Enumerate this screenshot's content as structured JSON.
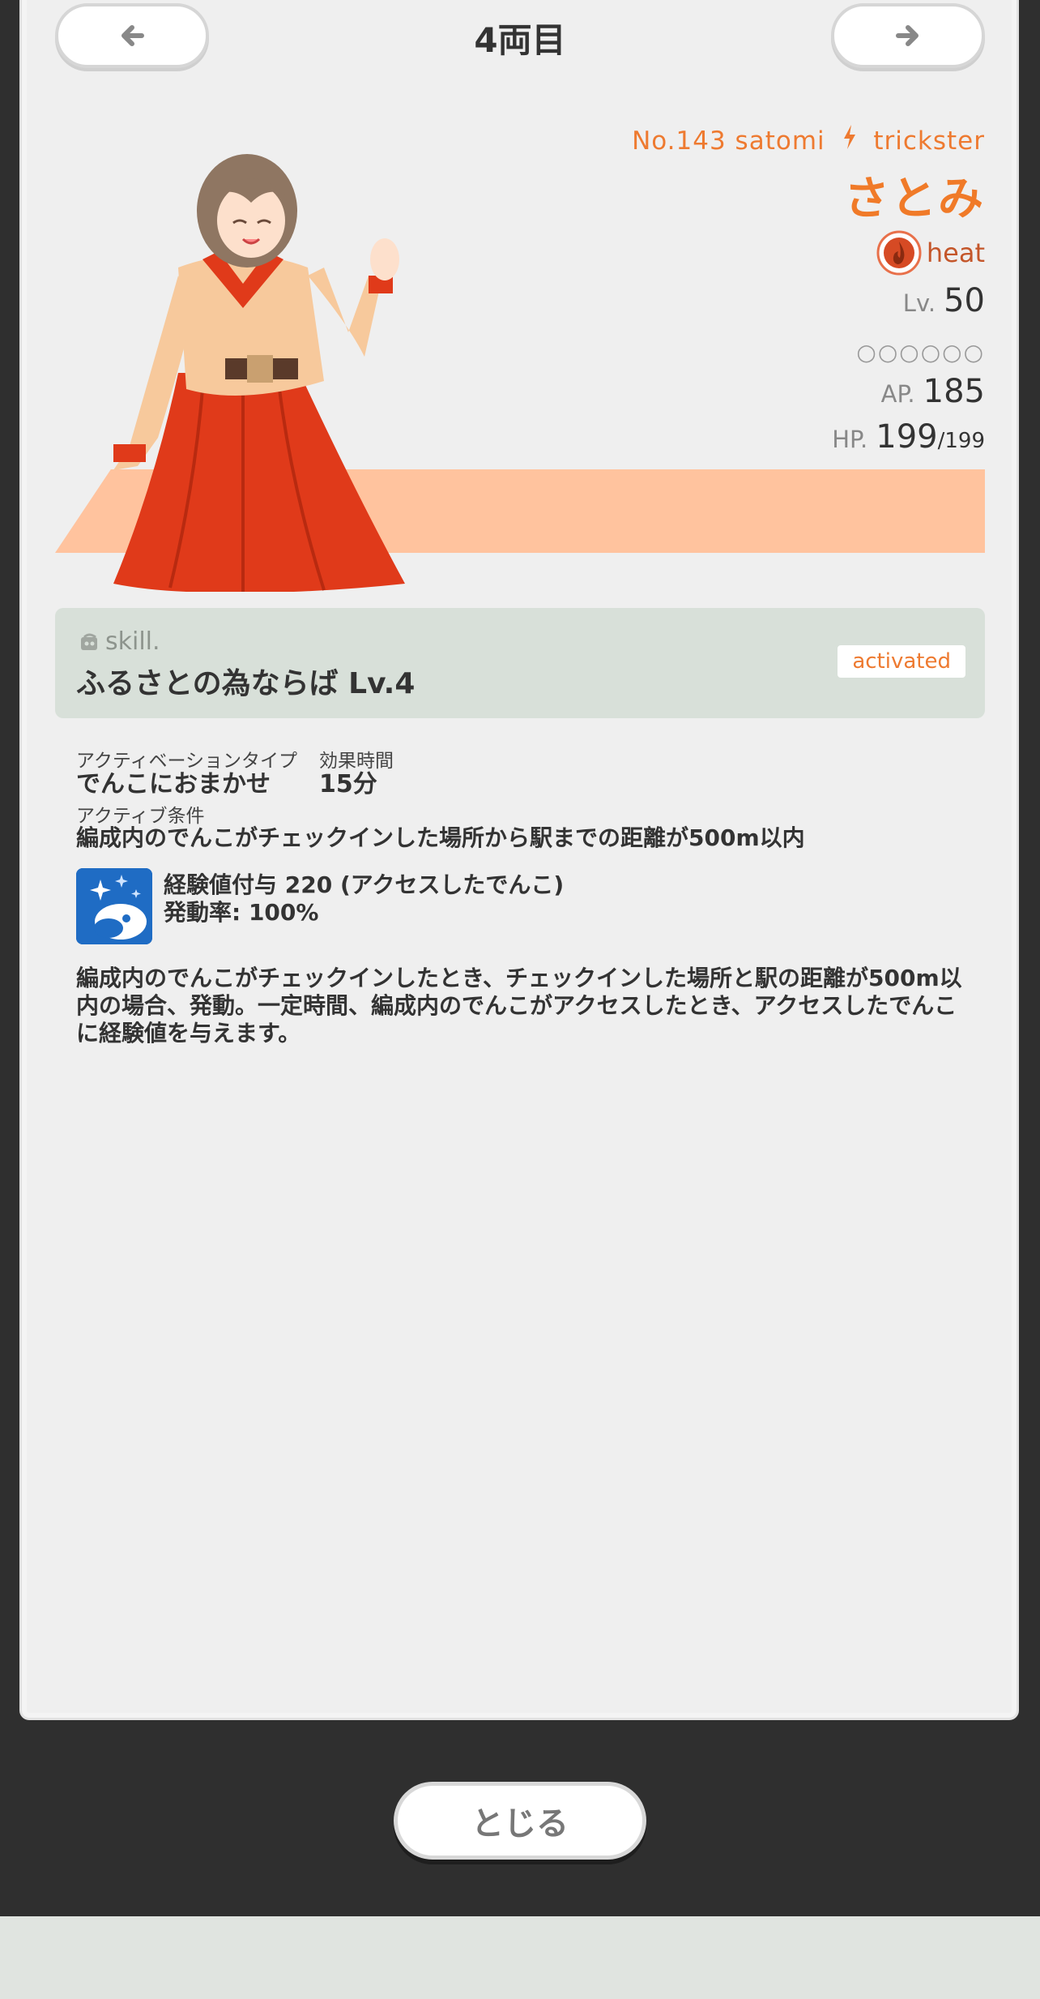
{
  "header": {
    "title": "4両目",
    "prev_icon": "arrow-left-icon",
    "next_icon": "arrow-right-icon"
  },
  "character": {
    "id_text": "No.143 satomi",
    "type": "trickster",
    "type_icon": "bolt-icon",
    "name": "さとみ",
    "element": "heat",
    "element_icon": "flame-icon",
    "level_label": "Lv.",
    "level": "50",
    "link_slots": "○○○○○○",
    "ap_label": "AP.",
    "ap": "185",
    "hp_label": "HP.",
    "hp": "199",
    "hp_max": "/199",
    "accent_color": "#f07a28",
    "stripe_color": "#ffc39e"
  },
  "skill": {
    "label": "skill.",
    "name": "ふるさとの為ならば Lv.4",
    "status": "activated",
    "activation_type_label": "アクティベーションタイプ",
    "activation_type": "でんこにおまかせ",
    "duration_label": "効果時間",
    "duration": "15分",
    "condition_label": "アクティブ条件",
    "condition": "編成内のでんこがチェックインした場所から駅までの距離が500m以内",
    "effect_line1": "経験値付与 220 (アクセスしたでんこ)",
    "effect_line2": "発動率: 100%",
    "effect_icon": "sparkle-planet-icon",
    "description": "編成内のでんこがチェックインしたとき、チェックインした場所と駅の距離が500m以内の場合、発動。一定時間、編成内のでんこがアクセスしたとき、アクセスしたでんこに経験値を与えます。"
  },
  "footer": {
    "close_label": "とじる"
  }
}
